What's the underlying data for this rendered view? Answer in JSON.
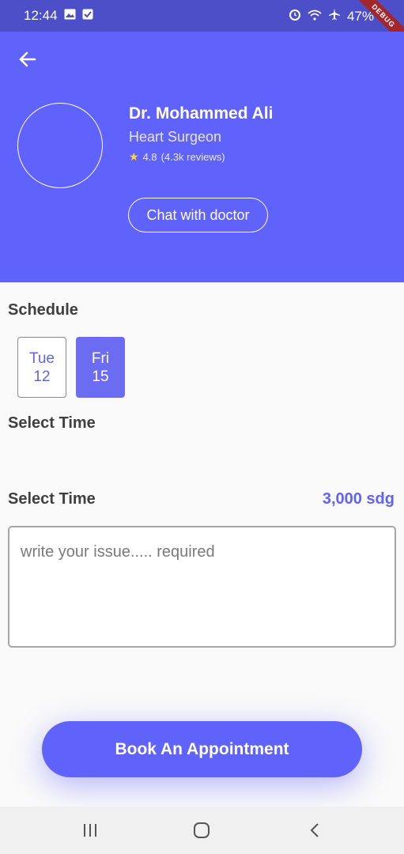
{
  "status_bar": {
    "time": "12:44",
    "battery": "47%",
    "icons_left": [
      "image-icon",
      "checkbox-icon"
    ],
    "icons_right": [
      "alarm-icon",
      "wifi-icon",
      "airplane-icon"
    ],
    "debug_label": "DEBUG"
  },
  "header": {
    "back_icon": "arrow-left-icon",
    "doctor_name": "Dr. Mohammed Ali",
    "specialty": "Heart Surgeon",
    "rating": "4.8",
    "reviews": "(4.3k reviews)",
    "chat_label": "Chat with doctor",
    "bg_color": "#6062fc"
  },
  "schedule": {
    "title": "Schedule",
    "days": [
      {
        "day": "Tue",
        "date": "12",
        "selected": false
      },
      {
        "day": "Fri",
        "date": "15",
        "selected": true
      }
    ]
  },
  "time_section": {
    "title": "Select Time"
  },
  "issue_section": {
    "title": "Select Time",
    "price": "3,000 sdg",
    "placeholder": "write your issue..... required"
  },
  "book_button": {
    "label": "Book An Appointment"
  },
  "nav_bar": {
    "items": [
      "recent-apps-icon",
      "home-icon",
      "back-icon"
    ]
  }
}
